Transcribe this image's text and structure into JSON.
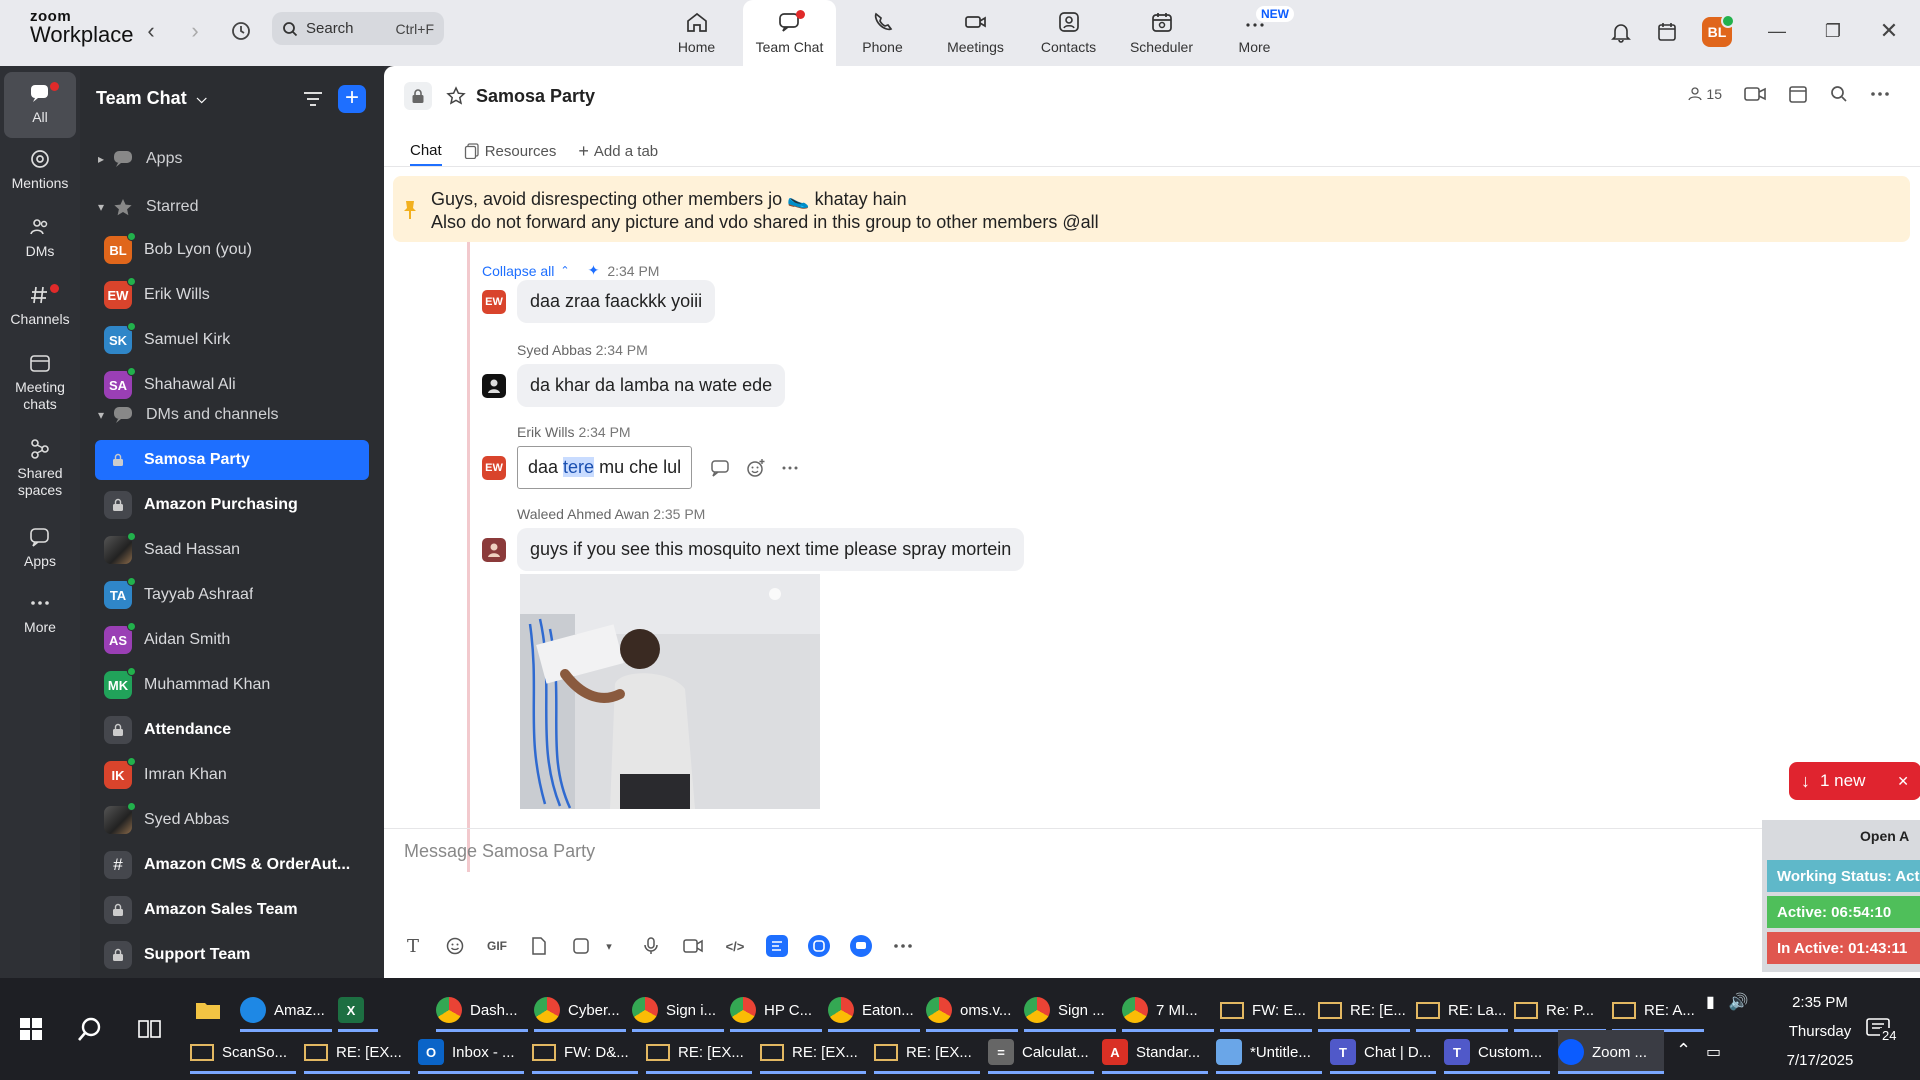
{
  "app": {
    "logo_top": "zoom",
    "logo_bottom": "Workplace",
    "search_placeholder": "Search",
    "search_shortcut": "Ctrl+F",
    "nav": [
      {
        "label": "Home",
        "icon": "home-icon"
      },
      {
        "label": "Team Chat",
        "icon": "chat-icon",
        "active": true
      },
      {
        "label": "Phone",
        "icon": "phone-icon"
      },
      {
        "label": "Meetings",
        "icon": "video-icon"
      },
      {
        "label": "Contacts",
        "icon": "contacts-icon"
      },
      {
        "label": "Scheduler",
        "icon": "scheduler-icon"
      },
      {
        "label": "More",
        "icon": "more-icon",
        "badge": "NEW"
      }
    ],
    "avatar_initials": "BL"
  },
  "rail": [
    {
      "label": "All"
    },
    {
      "label": "Mentions"
    },
    {
      "label": "DMs"
    },
    {
      "label": "Channels"
    },
    {
      "label": "Meeting chats"
    },
    {
      "label": "Shared spaces"
    },
    {
      "label": "Apps"
    },
    {
      "label": "More"
    }
  ],
  "sidebar": {
    "title": "Team Chat",
    "sections": {
      "apps": "Apps",
      "starred": "Starred",
      "dms": "DMs and channels"
    },
    "starred": [
      {
        "initials": "BL",
        "name": "Bob Lyon (you)",
        "color": "#e0661b"
      },
      {
        "initials": "EW",
        "name": "Erik Wills",
        "color": "#d9442c"
      },
      {
        "initials": "SK",
        "name": "Samuel Kirk",
        "color": "#2f86c8"
      },
      {
        "initials": "SA",
        "name": "Shahawal Ali",
        "color": "#9a3fb5"
      }
    ],
    "items": [
      {
        "type": "lock",
        "name": "Samosa Party",
        "active": true
      },
      {
        "type": "lock",
        "name": "Amazon Purchasing",
        "bold": true
      },
      {
        "type": "photo",
        "name": "Saad Hassan"
      },
      {
        "initials": "TA",
        "name": "Tayyab Ashraaf",
        "color": "#2f86c8"
      },
      {
        "initials": "AS",
        "name": "Aidan Smith",
        "color": "#9a3fb5"
      },
      {
        "initials": "MK",
        "name": "Muhammad Khan",
        "color": "#21a35a"
      },
      {
        "type": "lock",
        "name": "Attendance",
        "bold": true
      },
      {
        "initials": "IK",
        "name": "Imran Khan",
        "color": "#d9442c"
      },
      {
        "type": "photo",
        "name": "Syed Abbas"
      },
      {
        "type": "hash",
        "name": "Amazon CMS & OrderAut...",
        "bold": true
      },
      {
        "type": "lock",
        "name": "Amazon Sales Team",
        "bold": true
      },
      {
        "type": "lock",
        "name": "Support Team",
        "bold": true
      }
    ]
  },
  "channel": {
    "name": "Samosa Party",
    "members": "15",
    "tabs": [
      "Chat",
      "Resources",
      "Add a tab"
    ],
    "pinned_line1": "Guys, avoid disrespecting other members jo 🥿 khatay hain",
    "pinned_line2": "Also do not forward any picture and vdo shared in this group to other members @all",
    "collapse_label": "Collapse all",
    "collapse_time": "2:34 PM",
    "messages": [
      {
        "sender": "",
        "time": "",
        "text": "daa zraa faackkk yoiii",
        "av": "EW",
        "color": "#d9442c"
      },
      {
        "sender": "Syed Abbas",
        "time": "2:34 PM",
        "text": "da khar da lamba na wate ede",
        "av": "",
        "color": "#111"
      },
      {
        "sender": "Erik Wills",
        "time": "2:34 PM",
        "text_before": "daa ",
        "text_hl": "tere",
        "text_after": " mu che lul",
        "av": "EW",
        "color": "#d9442c"
      },
      {
        "sender": "Waleed Ahmed Awan",
        "time": "2:35 PM",
        "text": "guys if you see this mosquito next time please spray mortein",
        "av": "",
        "color": "#8b3a3a"
      }
    ],
    "new_count": "1 new",
    "composer_placeholder": "Message Samosa Party"
  },
  "widget": {
    "header": "Open A",
    "working": "Working Status: Active",
    "active": "Active: 06:54:10",
    "inactive": "In Active: 01:43:11"
  },
  "taskbar": {
    "row1": [
      "Amaz...",
      "",
      "Dash...",
      "Cyber...",
      "Sign i...",
      "HP C...",
      "Eaton...",
      "oms.v...",
      "Sign ...",
      "7 MI...",
      "FW: E...",
      "RE: [E...",
      "RE: La...",
      "Re: P...",
      "RE: A..."
    ],
    "row2": [
      "ScanSo...",
      "RE: [EX...",
      "Inbox - ...",
      "FW: D&...",
      "RE: [EX...",
      "RE: [EX...",
      "RE: [EX...",
      "Calculat...",
      "Standar...",
      "*Untitle...",
      "Chat | D...",
      "Custom...",
      "Zoom ..."
    ],
    "time": "2:35 PM",
    "day": "Thursday",
    "date": "7/17/2025",
    "notif_count": "24"
  }
}
